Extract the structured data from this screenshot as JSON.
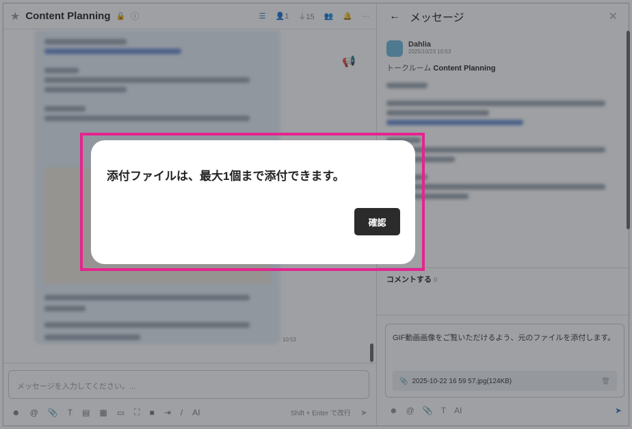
{
  "header": {
    "title": "Content Planning",
    "members": "1",
    "connections": "15"
  },
  "chat": {
    "time": "10:53",
    "input_placeholder": "メッセージを入力してください。...",
    "hint": "Shift + Enter で改行"
  },
  "panel": {
    "title": "メッセージ",
    "author": "Dahlia",
    "date": "2025/10/23 10:53",
    "room_label": "トークルーム",
    "room_name": "Content Planning",
    "comments_label": "コメントする",
    "comments_count": "0",
    "comment_text": "GIF動画画像をご覧いただけるよう、元のファイルを添付します。",
    "file_name": "2025-10-22 16 59 57.jpg(124KB)"
  },
  "dialog": {
    "message": "添付ファイルは、最大1個まで添付できます。",
    "confirm_label": "確認"
  },
  "colors": {
    "accent": "#3b6fc4",
    "highlight": "#e6238f"
  }
}
